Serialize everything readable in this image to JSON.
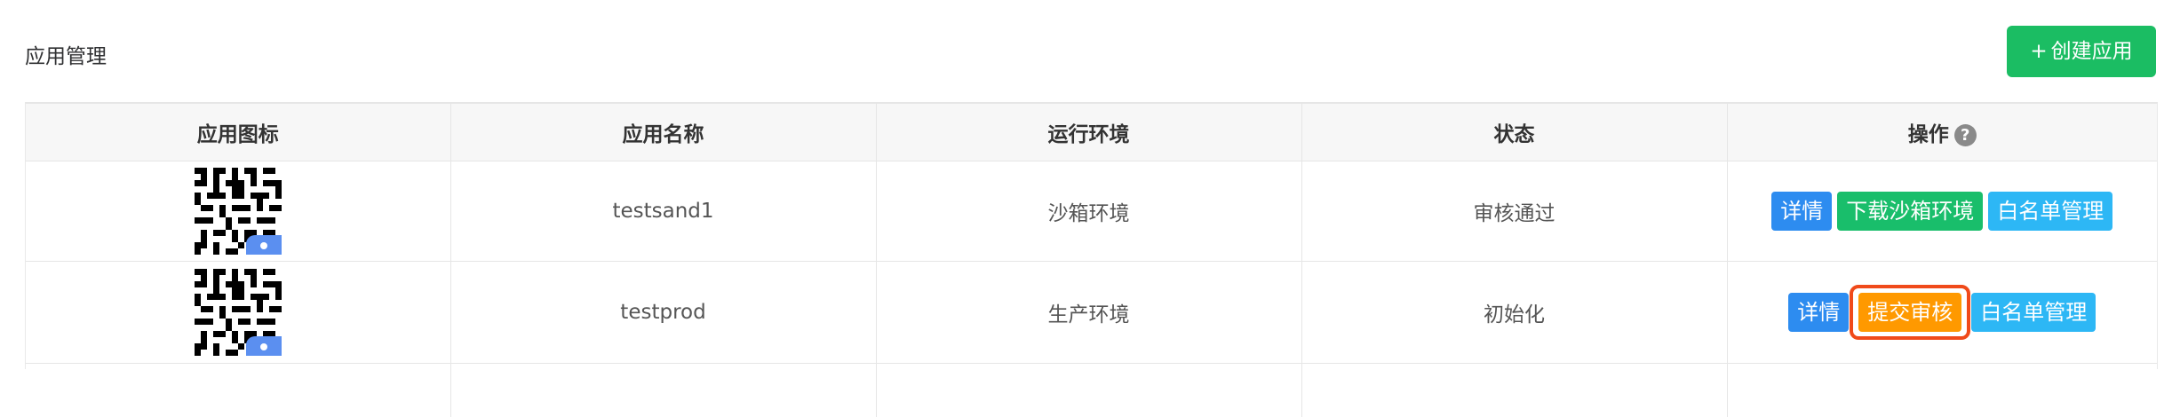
{
  "header": {
    "title": "应用管理",
    "create_button": {
      "plus": "+",
      "label": "创建应用"
    }
  },
  "table": {
    "columns": [
      "应用图标",
      "应用名称",
      "运行环境",
      "状态",
      "操作"
    ],
    "help_icon_glyph": "?",
    "rows": [
      {
        "icon": "qr-code-icon",
        "name": "testsand1",
        "environment": "沙箱环境",
        "status": "审核通过",
        "actions": [
          "详情",
          "下载沙箱环境",
          "白名单管理"
        ]
      },
      {
        "icon": "qr-code-icon",
        "name": "testprod",
        "environment": "生产环境",
        "status": "初始化",
        "actions": [
          "详情",
          "提交审核",
          "白名单管理"
        ]
      }
    ]
  },
  "colors": {
    "primary_green": "#1bbd63",
    "button_blue": "#2d8cf0",
    "button_green": "#19be6b",
    "button_cyan": "#2db7f5",
    "button_orange": "#ff9900",
    "highlight_outline": "#f04a1a"
  }
}
